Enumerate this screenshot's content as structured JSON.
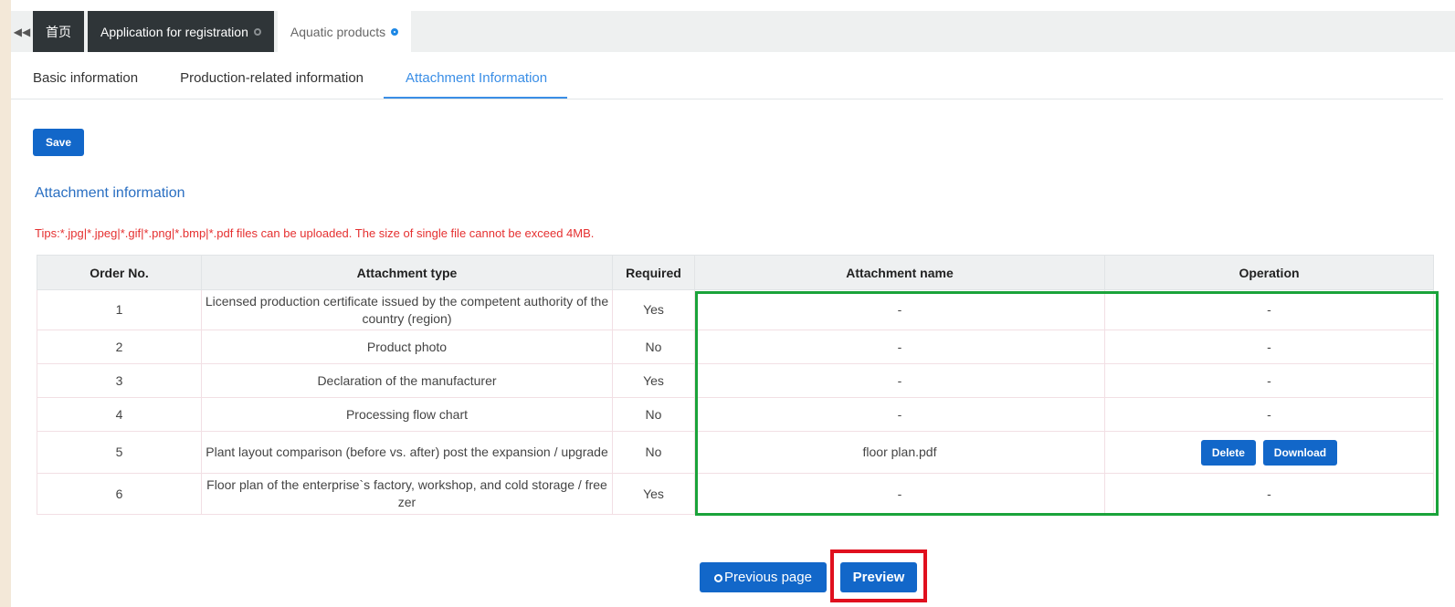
{
  "tabs": [
    {
      "label": "首页"
    },
    {
      "label": "Application for registration"
    },
    {
      "label": "Aquatic products"
    }
  ],
  "subtabs": [
    "Basic information",
    "Production-related information",
    "Attachment Information"
  ],
  "active_subtab": "Attachment Information",
  "save_label": "Save",
  "section_title": "Attachment information",
  "tips": "Tips:*.jpg|*.jpeg|*.gif|*.png|*.bmp|*.pdf files can be uploaded. The size of single file cannot be exceed 4MB.",
  "table": {
    "headers": [
      "Order No.",
      "Attachment type",
      "Required",
      "Attachment name",
      "Operation"
    ],
    "rows": [
      {
        "order": "1",
        "type": "Licensed production certificate issued by the competent authority of the country (region)",
        "required": "Yes",
        "name": "-",
        "operation": "-"
      },
      {
        "order": "2",
        "type": "Product photo",
        "required": "No",
        "name": "-",
        "operation": "-"
      },
      {
        "order": "3",
        "type": "Declaration of the manufacturer",
        "required": "Yes",
        "name": "-",
        "operation": "-"
      },
      {
        "order": "4",
        "type": "Processing flow chart",
        "required": "No",
        "name": "-",
        "operation": "-"
      },
      {
        "order": "5",
        "type": "Plant layout comparison (before vs. after) post the expansion / upgrade",
        "required": "No",
        "name": "floor plan.pdf",
        "operation": ""
      },
      {
        "order": "6",
        "type": "Floor plan of the enterprise`s factory, workshop, and cold storage / freezer",
        "required": "Yes",
        "name": "-",
        "operation": "-"
      }
    ],
    "row5_buttons": {
      "delete": "Delete",
      "download": "Download"
    }
  },
  "prev_label": "Previous page",
  "preview_label": "Preview",
  "colors": {
    "primary": "#1267c9",
    "tips": "#e53030",
    "link": "#3a8ee6",
    "highlight_green": "#1aa33a",
    "highlight_red": "#e0101e"
  },
  "icons": {
    "back": "double-left-arrow-icon",
    "tab_close": "circle-icon",
    "prev": "circle-icon"
  }
}
